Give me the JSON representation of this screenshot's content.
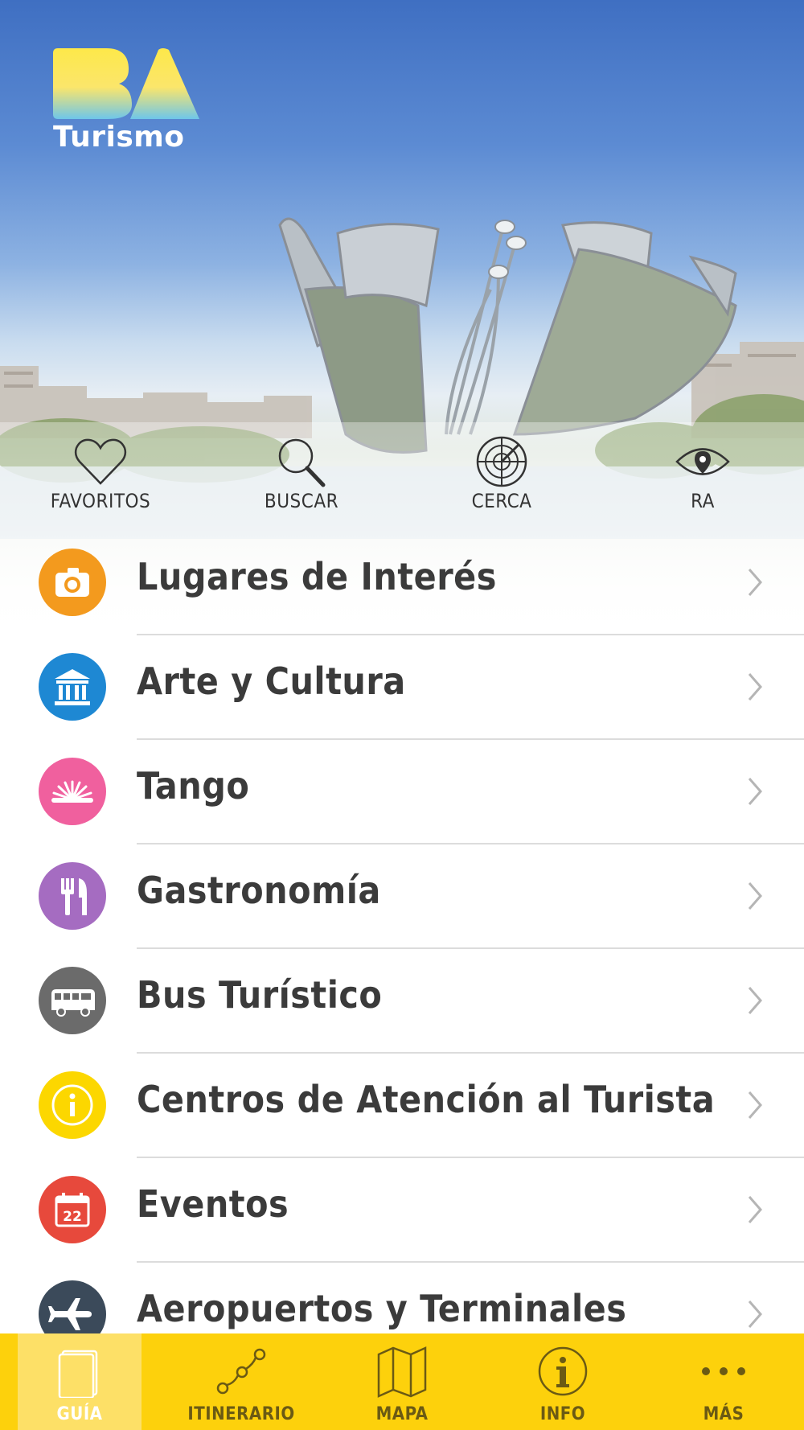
{
  "app": {
    "logo_text": "Turismo",
    "logo_mark": "BA"
  },
  "colors": {
    "accent_yellow": "#fdd10c",
    "orange": "#f39a1e",
    "blue": "#1e88d3",
    "pink": "#f0609e",
    "purple": "#a56cc1",
    "gray": "#6b6b6b",
    "yellow": "#fcd700",
    "red": "#e7493c",
    "navy": "#3b4a5a"
  },
  "quick_actions": [
    {
      "label": "FAVORITOS",
      "icon": "heart-icon"
    },
    {
      "label": "BUSCAR",
      "icon": "magnifier-icon"
    },
    {
      "label": "CERCA",
      "icon": "radar-icon"
    },
    {
      "label": "RA",
      "icon": "eye-icon"
    }
  ],
  "menu": [
    {
      "label": "Lugares de Interés",
      "icon": "camera-icon"
    },
    {
      "label": "Arte y Cultura",
      "icon": "museum-icon"
    },
    {
      "label": "Tango",
      "icon": "bandoneon-icon"
    },
    {
      "label": "Gastronomía",
      "icon": "cutlery-icon"
    },
    {
      "label": "Bus Turístico",
      "icon": "bus-icon"
    },
    {
      "label": "Centros de Atención al Turista",
      "icon": "info-icon"
    },
    {
      "label": "Eventos",
      "icon": "calendar-icon",
      "calendar_day": "22"
    },
    {
      "label": "Aeropuertos y Terminales",
      "icon": "airplane-icon"
    }
  ],
  "tabs": [
    {
      "label": "GUÍA",
      "icon": "guide-book-icon",
      "active": true
    },
    {
      "label": "ITINERARIO",
      "icon": "route-icon",
      "active": false
    },
    {
      "label": "MAPA",
      "icon": "map-icon",
      "active": false
    },
    {
      "label": "INFO",
      "icon": "info-circle-icon",
      "active": false
    },
    {
      "label": "MÁS",
      "icon": "more-dots-icon",
      "active": false
    }
  ]
}
